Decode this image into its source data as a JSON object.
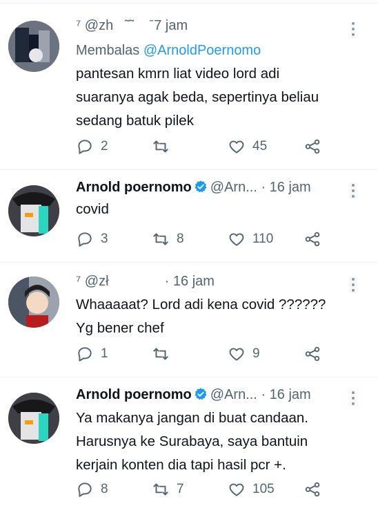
{
  "tweets": [
    {
      "username": "",
      "handle": "⁷ @zh    ˜˜    ˉ7",
      "time": "jam",
      "replying_prefix": "Membalas",
      "replying_to": "@ArnoldPoernomo",
      "text": "pantesan kmrn liat video lord adi suaranya agak beda, sepertinya beliau sedang batuk pilek",
      "lines": [
        "pantesan kmrn liat video lord adi",
        "suaranya agak beda, sepertinya beliau",
        "sedang batuk pilek"
      ],
      "replies": "2",
      "retweets": "",
      "likes": "45"
    },
    {
      "username": "Arnold poernomo",
      "handle": "@Arn...",
      "time": "· 16 jam",
      "lines": [
        "covid"
      ],
      "replies": "3",
      "retweets": "8",
      "likes": "110"
    },
    {
      "username": "",
      "handle": "⁷ @zł",
      "time": "· 16 jam",
      "lines": [
        "Whaaaaat? Lord adi kena covid ??????",
        "Yg bener chef"
      ],
      "replies": "1",
      "retweets": "",
      "likes": "9"
    },
    {
      "username": "Arnold poernomo",
      "handle": "@Arn...",
      "time": "· 16 jam",
      "lines": [
        "Ya makanya jangan di buat candaan.",
        "Harusnya ke Surabaya, saya bantuin",
        "kerjain konten dia tapi hasil pcr +."
      ],
      "replies": "8",
      "retweets": "7",
      "likes": "105"
    }
  ],
  "icons": {
    "reply": "reply-icon",
    "retweet": "retweet-icon",
    "like": "heart-icon",
    "share": "share-icon",
    "verified": "verified-badge-icon",
    "more": "more-options-icon"
  },
  "colors": {
    "accent": "#1d9bf0",
    "muted": "#536471",
    "text": "#0f1419"
  }
}
